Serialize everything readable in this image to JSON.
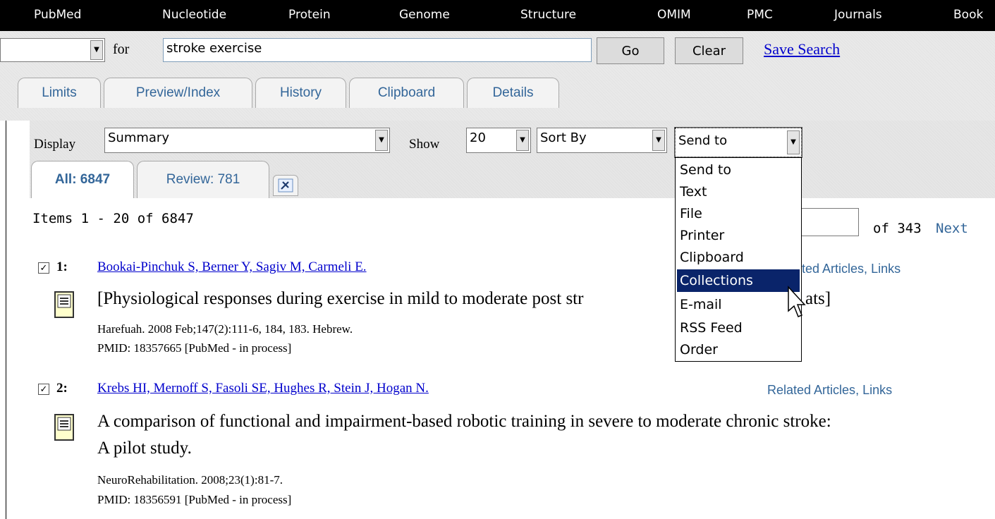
{
  "nav": [
    "PubMed",
    "Nucleotide",
    "Protein",
    "Genome",
    "Structure",
    "OMIM",
    "PMC",
    "Journals",
    "Book"
  ],
  "search": {
    "for_label": "for",
    "query": "stroke exercise",
    "go": "Go",
    "clear": "Clear",
    "save": "Save Search"
  },
  "tabs": [
    "Limits",
    "Preview/Index",
    "History",
    "Clipboard",
    "Details"
  ],
  "display": {
    "label": "Display",
    "value": "Summary",
    "show_label": "Show",
    "show_value": "20",
    "sort": "Sort By",
    "send": "Send to"
  },
  "subtabs": {
    "all": "All: 6847",
    "review": "Review: 781"
  },
  "items_text": "Items 1 - 20 of 6847",
  "pager": {
    "of": "of 343",
    "next": "Next"
  },
  "dropdown": {
    "options": [
      "Send to",
      "Text",
      "File",
      "Printer",
      "Clipboard",
      "Collections",
      "E-mail",
      "RSS Feed",
      "Order"
    ],
    "selected_index": 5
  },
  "results": [
    {
      "num": "1:",
      "authors": "Bookai-Pinchuk S, Berner Y, Sagiv M, Carmeli E.",
      "title": "[Physiological responses during exercise in mild to moderate post str",
      "title_tail": "ats]",
      "journal": "Harefuah. 2008 Feb;147(2):111-6, 184, 183. Hebrew.",
      "pmid": "PMID: 18357665 [PubMed - in process]",
      "related": "ted Articles",
      "links": "Links"
    },
    {
      "num": "2:",
      "authors": "Krebs HI, Mernoff S, Fasoli SE, Hughes R, Stein J, Hogan N.",
      "title": "A comparison of functional and impairment-based robotic training in severe to moderate chronic stroke:",
      "title2": "A pilot study.",
      "journal": "NeuroRehabilitation. 2008;23(1):81-7.",
      "pmid": "PMID: 18356591 [PubMed - in process]",
      "related": "Related Articles",
      "links": "Links"
    }
  ]
}
